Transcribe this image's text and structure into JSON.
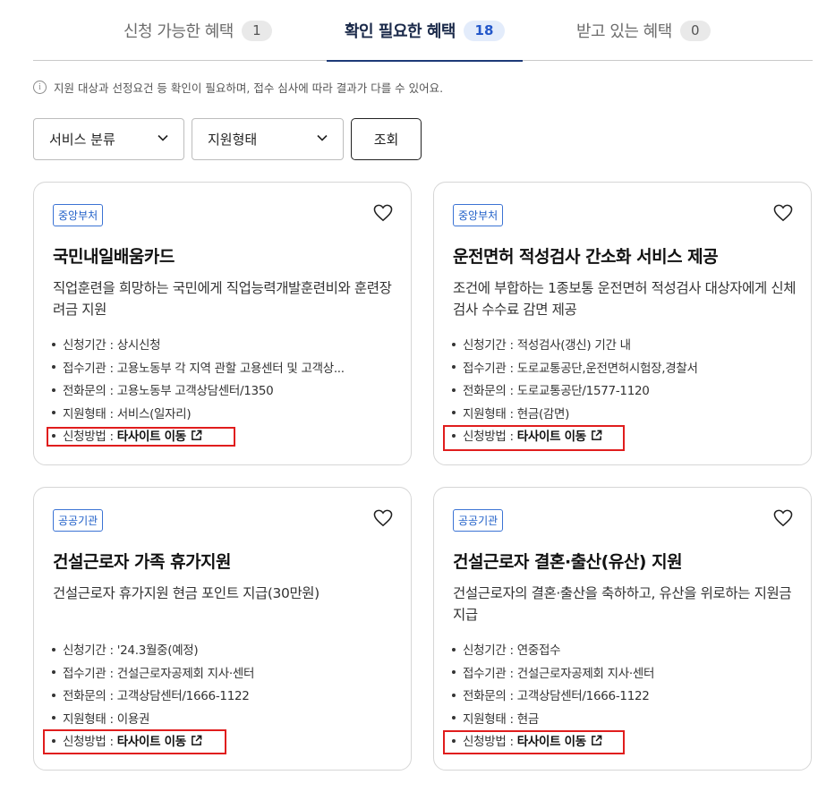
{
  "tabs": [
    {
      "label": "신청 가능한 혜택",
      "count": "1"
    },
    {
      "label": "확인 필요한 혜택",
      "count": "18"
    },
    {
      "label": "받고 있는 혜택",
      "count": "0"
    }
  ],
  "notice": "지원 대상과 선정요건 등 확인이 필요하며, 접수 심사에 따라 결과가 다를 수 있어요.",
  "filters": {
    "category": "서비스 분류",
    "support_type": "지원형태",
    "search_button": "조회"
  },
  "colors": {
    "accent": "#1d3a78",
    "badge": "#3b73d4",
    "highlight": "#e01d1d"
  },
  "cards": [
    {
      "badge": "중앙부처",
      "title": "국민내일배움카드",
      "desc": "직업훈련을 희망하는 국민에게 직업능력개발훈련비와 훈련장려금 지원",
      "period": "신청기간 : 상시신청",
      "agency": "접수기관 : 고용노동부 각 지역 관할 고용센터 및 고객상...",
      "contact": "전화문의 : 고용노동부 고객상담센터/1350",
      "support": "지원형태 : 서비스(일자리)",
      "method_label": "신청방법 : ",
      "method_link": "타사이트 이동"
    },
    {
      "badge": "중앙부처",
      "title": "운전면허 적성검사 간소화 서비스 제공",
      "desc": "조건에 부합하는 1종보통 운전면허 적성검사 대상자에게 신체검사 수수료 감면 제공",
      "period": "신청기간 : 적성검사(갱신) 기간 내",
      "agency": "접수기관 : 도로교통공단,운전면허시험장,경찰서",
      "contact": "전화문의 : 도로교통공단/1577-1120",
      "support": "지원형태 : 현금(감면)",
      "method_label": "신청방법 : ",
      "method_link": "타사이트 이동"
    },
    {
      "badge": "공공기관",
      "title": "건설근로자 가족 휴가지원",
      "desc": "건설근로자 휴가지원 현금 포인트 지급(30만원)",
      "period": "신청기간 : '24.3월중(예정)",
      "agency": "접수기관 : 건설근로자공제회 지사·센터",
      "contact": "전화문의 : 고객상담센터/1666-1122",
      "support": "지원형태 : 이용권",
      "method_label": "신청방법 : ",
      "method_link": "타사이트 이동"
    },
    {
      "badge": "공공기관",
      "title": "건설근로자 결혼·출산(유산) 지원",
      "desc": "건설근로자의 결혼·출산을 축하하고, 유산을 위로하는 지원금 지급",
      "period": "신청기간 : 연중접수",
      "agency": "접수기관 : 건설근로자공제회 지사·센터",
      "contact": "전화문의 : 고객상담센터/1666-1122",
      "support": "지원형태 : 현금",
      "method_label": "신청방법 : ",
      "method_link": "타사이트 이동"
    }
  ]
}
